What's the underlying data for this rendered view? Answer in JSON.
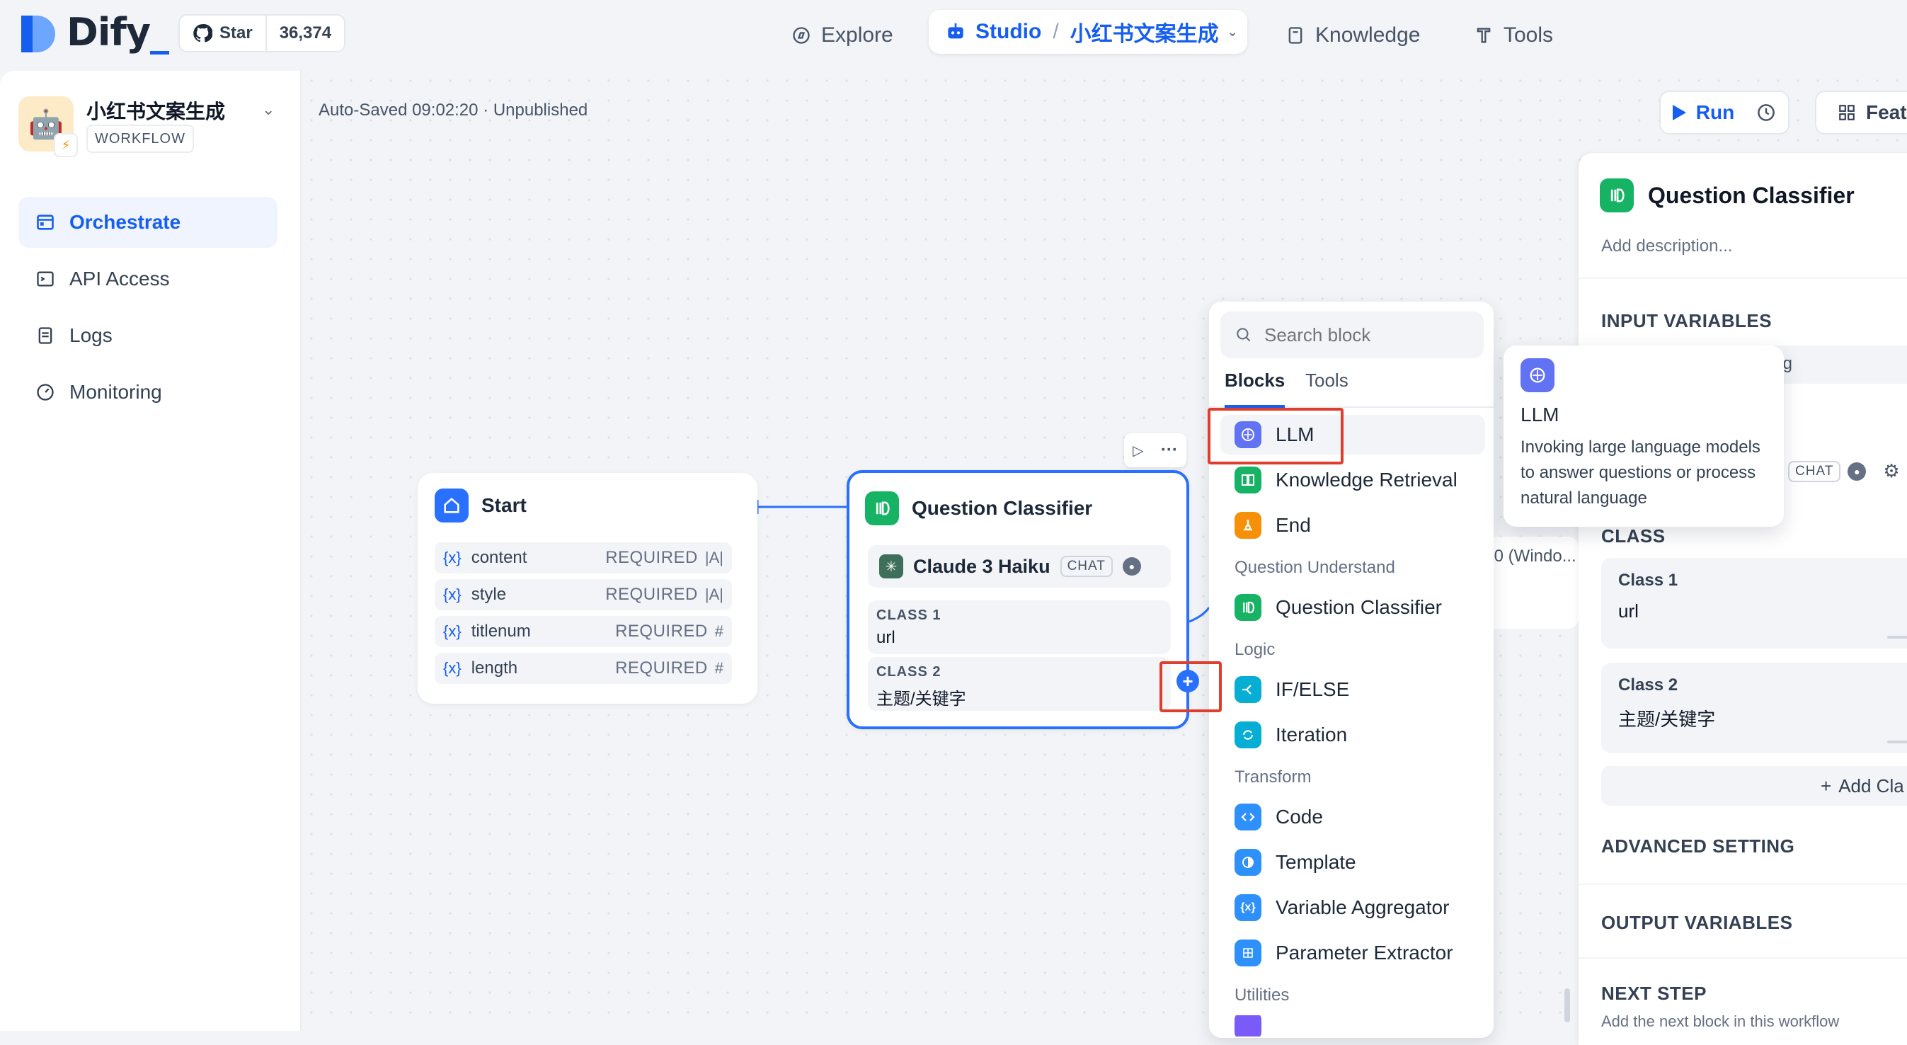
{
  "brand": {
    "name": "Dify"
  },
  "github": {
    "star_label": "Star",
    "count": "36,374"
  },
  "nav": {
    "explore": "Explore",
    "studio": "Studio",
    "separator": "/",
    "current_app": "小红书文案生成",
    "knowledge": "Knowledge",
    "tools": "Tools"
  },
  "app": {
    "name": "小红书文案生成",
    "type": "WORKFLOW"
  },
  "sidebar": {
    "items": [
      {
        "label": "Orchestrate",
        "icon": "orchestrate-icon",
        "active": true
      },
      {
        "label": "API Access",
        "icon": "terminal-icon"
      },
      {
        "label": "Logs",
        "icon": "logs-icon"
      },
      {
        "label": "Monitoring",
        "icon": "monitoring-icon"
      }
    ]
  },
  "toolbar": {
    "status": "Auto-Saved 09:02:20 · Unpublished",
    "run": "Run",
    "features": "Featu"
  },
  "start_node": {
    "title": "Start",
    "vars": [
      {
        "name": "content",
        "req": "REQUIRED",
        "type": "|A|"
      },
      {
        "name": "style",
        "req": "REQUIRED",
        "type": "|A|"
      },
      {
        "name": "titlenum",
        "req": "REQUIRED",
        "type": "#"
      },
      {
        "name": "length",
        "req": "REQUIRED",
        "type": "#"
      }
    ]
  },
  "qc_node": {
    "title": "Question Classifier",
    "model": "Claude 3 Haiku",
    "model_mode": "CHAT",
    "classes": [
      {
        "label": "CLASS 1",
        "value": "url"
      },
      {
        "label": "CLASS 2",
        "value": "主题/关键字"
      }
    ]
  },
  "block_selector": {
    "search_placeholder": "Search block",
    "tabs": [
      "Blocks",
      "Tools"
    ],
    "items": [
      {
        "label": "LLM",
        "color": "#6172f3"
      },
      {
        "label": "Knowledge Retrieval",
        "color": "#16b364"
      },
      {
        "label": "End",
        "color": "#f79009"
      },
      {
        "group": "Question Understand"
      },
      {
        "label": "Question Classifier",
        "color": "#16b364"
      },
      {
        "group": "Logic"
      },
      {
        "label": "IF/ELSE",
        "color": "#06aed4"
      },
      {
        "label": "Iteration",
        "color": "#06aed4"
      },
      {
        "group": "Transform"
      },
      {
        "label": "Code",
        "color": "#2e90fa"
      },
      {
        "label": "Template",
        "color": "#2e90fa"
      },
      {
        "label": "Variable Aggregator",
        "color": "#2e90fa"
      },
      {
        "label": "Parameter Extractor",
        "color": "#2e90fa"
      },
      {
        "group": "Utilities"
      }
    ]
  },
  "tooltip": {
    "title": "LLM",
    "description": "Invoking large language models to answer questions or process natural language"
  },
  "panel": {
    "title": "Question Classifier",
    "description_placeholder": "Add description...",
    "input_variables": "INPUT VARIABLES",
    "input_hint": "ing",
    "model_mode": "CHAT",
    "class_section": "CLASS",
    "classes": [
      {
        "label": "Class 1",
        "value": "url"
      },
      {
        "label": "Class 2",
        "value": "主题/关键字"
      }
    ],
    "add_class": "Add Cla",
    "advanced": "ADVANCED SETTING",
    "output": "OUTPUT VARIABLES",
    "next_step": "NEXT STEP",
    "next_step_hint": "Add the next block in this workflow"
  },
  "background_node": {
    "text": ".0 (Windo..."
  },
  "colors": {
    "accent": "#155eef",
    "highlight": "#e03e2d",
    "green": "#16b364"
  }
}
